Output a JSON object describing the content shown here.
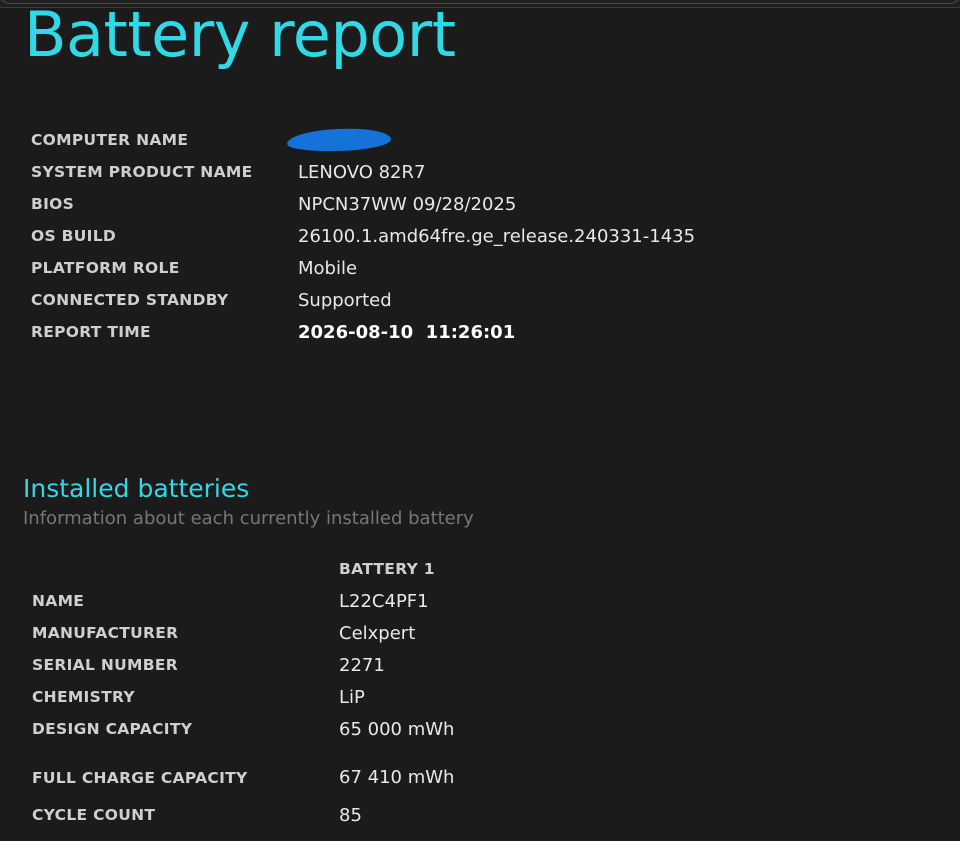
{
  "report": {
    "title": "Battery report"
  },
  "system_info": [
    {
      "label": "COMPUTER NAME",
      "value": "",
      "redacted": true
    },
    {
      "label": "SYSTEM PRODUCT NAME",
      "value": "LENOVO 82R7"
    },
    {
      "label": "BIOS",
      "value": "NPCN37WW 09/28/2025"
    },
    {
      "label": "OS BUILD",
      "value": "26100.1.amd64fre.ge_release.240331-1435"
    },
    {
      "label": "PLATFORM ROLE",
      "value": "Mobile"
    },
    {
      "label": "CONNECTED STANDBY",
      "value": "Supported"
    },
    {
      "label": "REPORT TIME",
      "value": "2026-08-10  11:26:01"
    }
  ],
  "installed_batteries": {
    "title": "Installed batteries",
    "subtitle": "Information about each currently installed battery",
    "column_header": "BATTERY 1",
    "rows": [
      {
        "label": "NAME",
        "value": "L22C4PF1"
      },
      {
        "label": "MANUFACTURER",
        "value": "Celxpert"
      },
      {
        "label": "SERIAL NUMBER",
        "value": "2271"
      },
      {
        "label": "CHEMISTRY",
        "value": "LiP"
      },
      {
        "label": "DESIGN CAPACITY",
        "value": "65 000 mWh"
      },
      {
        "label": "FULL CHARGE CAPACITY",
        "value": "67 410 mWh"
      },
      {
        "label": "CYCLE COUNT",
        "value": "85"
      }
    ]
  },
  "colors": {
    "background": "#1b1b1b",
    "accent": "#2fd9e6",
    "redaction": "#1472d8"
  }
}
